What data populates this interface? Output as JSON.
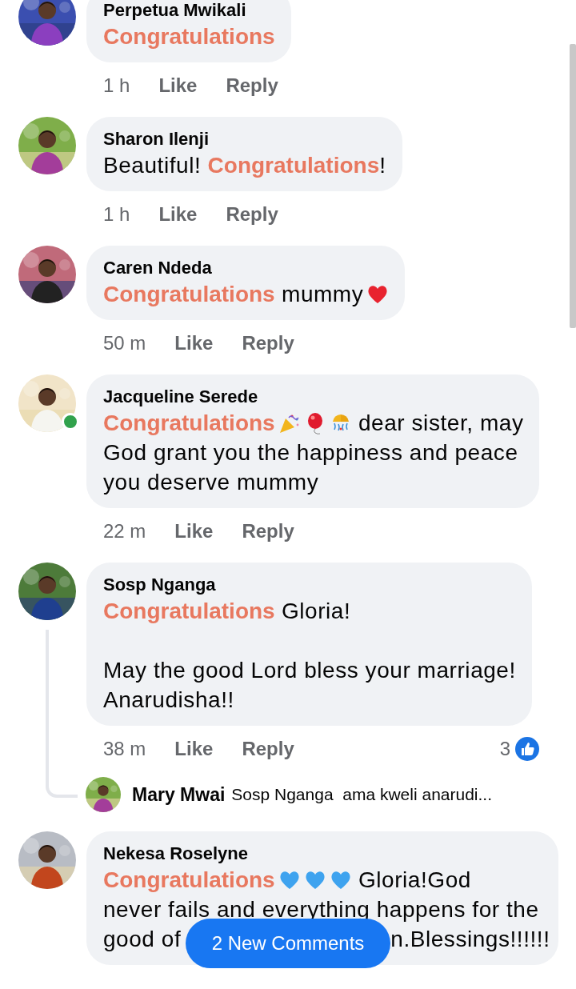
{
  "comments": [
    {
      "author": "Perpetua Mwikali",
      "online": false,
      "paragraphs": [
        [
          [
            {
              "kind": "highlight",
              "text": "Congratulations"
            }
          ]
        ]
      ],
      "time": "1 h",
      "like": "Like",
      "reply": "Reply"
    },
    {
      "author": "Sharon Ilenji",
      "online": false,
      "paragraphs": [
        [
          [
            {
              "kind": "text",
              "text": "Beautiful! "
            },
            {
              "kind": "highlight",
              "text": "Congratulations"
            },
            {
              "kind": "text",
              "text": "!"
            }
          ]
        ]
      ],
      "time": "1 h",
      "like": "Like",
      "reply": "Reply"
    },
    {
      "author": "Caren Ndeda",
      "online": false,
      "paragraphs": [
        [
          [
            {
              "kind": "highlight",
              "text": "Congratulations"
            },
            {
              "kind": "text",
              "text": " mummy"
            },
            {
              "kind": "heart"
            }
          ]
        ]
      ],
      "time": "50 m",
      "like": "Like",
      "reply": "Reply"
    },
    {
      "author": "Jacqueline Serede",
      "online": true,
      "paragraphs": [
        [
          [
            {
              "kind": "highlight",
              "text": "Congratulations"
            },
            {
              "kind": "popper"
            },
            {
              "kind": "balloon"
            },
            {
              "kind": "confetti"
            },
            {
              "kind": "text",
              "text": " dear sister, may"
            }
          ],
          [
            {
              "kind": "text",
              "text": "God grant you the happiness and peace"
            }
          ],
          [
            {
              "kind": "text",
              "text": "you deserve mummy"
            }
          ]
        ]
      ],
      "time": "22 m",
      "like": "Like",
      "reply": "Reply"
    },
    {
      "author": "Sosp Nganga",
      "online": false,
      "paragraphs": [
        [
          [
            {
              "kind": "highlight",
              "text": "Congratulations"
            },
            {
              "kind": "text",
              "text": " Gloria!"
            }
          ]
        ],
        [
          [
            {
              "kind": "text",
              "text": "May the good Lord bless your marriage!"
            }
          ],
          [
            {
              "kind": "text",
              "text": "Anarudisha!!"
            }
          ]
        ]
      ],
      "time": "38 m",
      "like": "Like",
      "reply": "Reply",
      "reactions": "3",
      "replies": [
        {
          "author": "Mary Mwai",
          "text": "Sosp Nganga  ama kweli anarudi..."
        }
      ]
    },
    {
      "author": "Nekesa Roselyne",
      "online": false,
      "paragraphs": [
        [
          [
            {
              "kind": "highlight",
              "text": "Congratulations"
            },
            {
              "kind": "blue_heart"
            },
            {
              "kind": "blue_heart"
            },
            {
              "kind": "blue_heart"
            },
            {
              "kind": "text",
              "text": " Gloria!God"
            }
          ],
          [
            {
              "kind": "text",
              "text": "never fails and everything happens for the"
            }
          ],
          [
            {
              "kind": "text",
              "text": "good of"
            },
            {
              "kind": "covered"
            },
            {
              "kind": "text",
              "text": "n.Blessings!!!!!!"
            }
          ]
        ]
      ]
    }
  ],
  "new_comments_button": "2 New Comments"
}
